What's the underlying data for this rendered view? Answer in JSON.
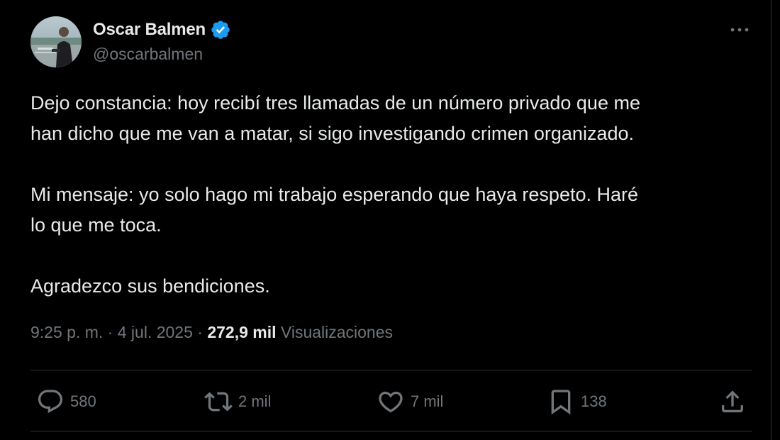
{
  "author": {
    "display_name": "Oscar Balmen",
    "handle": "@oscarbalmen",
    "verified_color": "#1d9bf0"
  },
  "tweet": {
    "paragraphs": [
      "Dejo constancia: hoy recibí tres llamadas de un número privado que me\nhan dicho que me van a matar, si sigo investigando crimen organizado.",
      "Mi mensaje: yo solo hago mi trabajo esperando que haya respeto. Haré\nlo que me toca.",
      "Agradezco sus bendiciones."
    ],
    "time": "9:25 p. m.",
    "separator": "·",
    "date": "4 jul. 2025",
    "views_count": "272,9 mil",
    "views_label": "Visualizaciones"
  },
  "actions": {
    "replies": "580",
    "reposts": "2 mil",
    "likes": "7 mil",
    "bookmarks": "138"
  },
  "icons": {
    "more": "more-icon",
    "reply": "reply-icon",
    "repost": "repost-icon",
    "like": "heart-icon",
    "bookmark": "bookmark-icon",
    "share": "share-icon",
    "verified": "verified-badge-icon"
  },
  "colors": {
    "background": "#000000",
    "text": "#e7e9ea",
    "secondary": "#71767b",
    "border": "#2f3336"
  }
}
